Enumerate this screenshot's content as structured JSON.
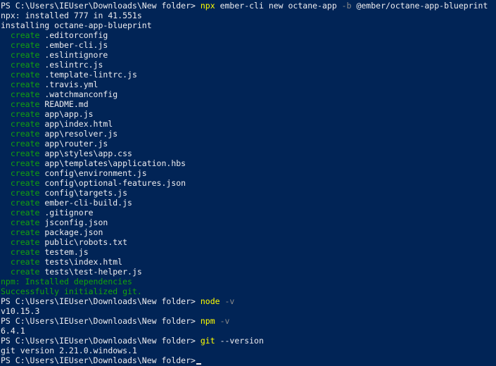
{
  "terminal": {
    "prompt": "PS C:\\Users\\IEUser\\Downloads\\New folder>",
    "lines": [
      {
        "segments": [
          {
            "t": "PS C:\\Users\\IEUser\\Downloads\\New folder> ",
            "c": "default"
          },
          {
            "t": "npx",
            "c": "cmd"
          },
          {
            "t": " ember-cli new octane-app ",
            "c": "default"
          },
          {
            "t": "-b",
            "c": "param"
          },
          {
            "t": " @ember/octane-app-blueprint",
            "c": "default"
          }
        ]
      },
      {
        "segments": [
          {
            "t": "npx: installed 777 in 41.551s",
            "c": "default"
          }
        ]
      },
      {
        "segments": [
          {
            "t": "installing octane-app-blueprint",
            "c": "default"
          }
        ]
      },
      {
        "segments": [
          {
            "t": "  create",
            "c": "create"
          },
          {
            "t": " .editorconfig",
            "c": "default"
          }
        ]
      },
      {
        "segments": [
          {
            "t": "  create",
            "c": "create"
          },
          {
            "t": " .ember-cli.js",
            "c": "default"
          }
        ]
      },
      {
        "segments": [
          {
            "t": "  create",
            "c": "create"
          },
          {
            "t": " .eslintignore",
            "c": "default"
          }
        ]
      },
      {
        "segments": [
          {
            "t": "  create",
            "c": "create"
          },
          {
            "t": " .eslintrc.js",
            "c": "default"
          }
        ]
      },
      {
        "segments": [
          {
            "t": "  create",
            "c": "create"
          },
          {
            "t": " .template-lintrc.js",
            "c": "default"
          }
        ]
      },
      {
        "segments": [
          {
            "t": "  create",
            "c": "create"
          },
          {
            "t": " .travis.yml",
            "c": "default"
          }
        ]
      },
      {
        "segments": [
          {
            "t": "  create",
            "c": "create"
          },
          {
            "t": " .watchmanconfig",
            "c": "default"
          }
        ]
      },
      {
        "segments": [
          {
            "t": "  create",
            "c": "create"
          },
          {
            "t": " README.md",
            "c": "default"
          }
        ]
      },
      {
        "segments": [
          {
            "t": "  create",
            "c": "create"
          },
          {
            "t": " app\\app.js",
            "c": "default"
          }
        ]
      },
      {
        "segments": [
          {
            "t": "  create",
            "c": "create"
          },
          {
            "t": " app\\index.html",
            "c": "default"
          }
        ]
      },
      {
        "segments": [
          {
            "t": "  create",
            "c": "create"
          },
          {
            "t": " app\\resolver.js",
            "c": "default"
          }
        ]
      },
      {
        "segments": [
          {
            "t": "  create",
            "c": "create"
          },
          {
            "t": " app\\router.js",
            "c": "default"
          }
        ]
      },
      {
        "segments": [
          {
            "t": "  create",
            "c": "create"
          },
          {
            "t": " app\\styles\\app.css",
            "c": "default"
          }
        ]
      },
      {
        "segments": [
          {
            "t": "  create",
            "c": "create"
          },
          {
            "t": " app\\templates\\application.hbs",
            "c": "default"
          }
        ]
      },
      {
        "segments": [
          {
            "t": "  create",
            "c": "create"
          },
          {
            "t": " config\\environment.js",
            "c": "default"
          }
        ]
      },
      {
        "segments": [
          {
            "t": "  create",
            "c": "create"
          },
          {
            "t": " config\\optional-features.json",
            "c": "default"
          }
        ]
      },
      {
        "segments": [
          {
            "t": "  create",
            "c": "create"
          },
          {
            "t": " config\\targets.js",
            "c": "default"
          }
        ]
      },
      {
        "segments": [
          {
            "t": "  create",
            "c": "create"
          },
          {
            "t": " ember-cli-build.js",
            "c": "default"
          }
        ]
      },
      {
        "segments": [
          {
            "t": "  create",
            "c": "create"
          },
          {
            "t": " .gitignore",
            "c": "default"
          }
        ]
      },
      {
        "segments": [
          {
            "t": "  create",
            "c": "create"
          },
          {
            "t": " jsconfig.json",
            "c": "default"
          }
        ]
      },
      {
        "segments": [
          {
            "t": "  create",
            "c": "create"
          },
          {
            "t": " package.json",
            "c": "default"
          }
        ]
      },
      {
        "segments": [
          {
            "t": "  create",
            "c": "create"
          },
          {
            "t": " public\\robots.txt",
            "c": "default"
          }
        ]
      },
      {
        "segments": [
          {
            "t": "  create",
            "c": "create"
          },
          {
            "t": " testem.js",
            "c": "default"
          }
        ]
      },
      {
        "segments": [
          {
            "t": "  create",
            "c": "create"
          },
          {
            "t": " tests\\index.html",
            "c": "default"
          }
        ]
      },
      {
        "segments": [
          {
            "t": "  create",
            "c": "create"
          },
          {
            "t": " tests\\test-helper.js",
            "c": "default"
          }
        ]
      },
      {
        "segments": [
          {
            "t": "npm: Installed dependencies",
            "c": "npm-ok"
          }
        ]
      },
      {
        "segments": [
          {
            "t": "Successfully initialized git.",
            "c": "npm-ok"
          }
        ]
      },
      {
        "segments": [
          {
            "t": "PS C:\\Users\\IEUser\\Downloads\\New folder> ",
            "c": "default"
          },
          {
            "t": "node",
            "c": "cmd"
          },
          {
            "t": " -v",
            "c": "param"
          }
        ]
      },
      {
        "segments": [
          {
            "t": "v10.15.3",
            "c": "default"
          }
        ]
      },
      {
        "segments": [
          {
            "t": "PS C:\\Users\\IEUser\\Downloads\\New folder> ",
            "c": "default"
          },
          {
            "t": "npm",
            "c": "cmd"
          },
          {
            "t": " -v",
            "c": "param"
          }
        ]
      },
      {
        "segments": [
          {
            "t": "6.4.1",
            "c": "default"
          }
        ]
      },
      {
        "segments": [
          {
            "t": "PS C:\\Users\\IEUser\\Downloads\\New folder> ",
            "c": "default"
          },
          {
            "t": "git",
            "c": "cmd"
          },
          {
            "t": " --version",
            "c": "default"
          }
        ]
      },
      {
        "segments": [
          {
            "t": "git version 2.21.0.windows.1",
            "c": "default"
          }
        ]
      }
    ],
    "current_prompt": "PS C:\\Users\\IEUser\\Downloads\\New folder>",
    "colors": {
      "background": "#012456",
      "foreground": "#eeedf0",
      "command": "#ffff00",
      "parameter": "#8a8a8a",
      "create": "#13a10e",
      "success": "#13a10e"
    }
  }
}
